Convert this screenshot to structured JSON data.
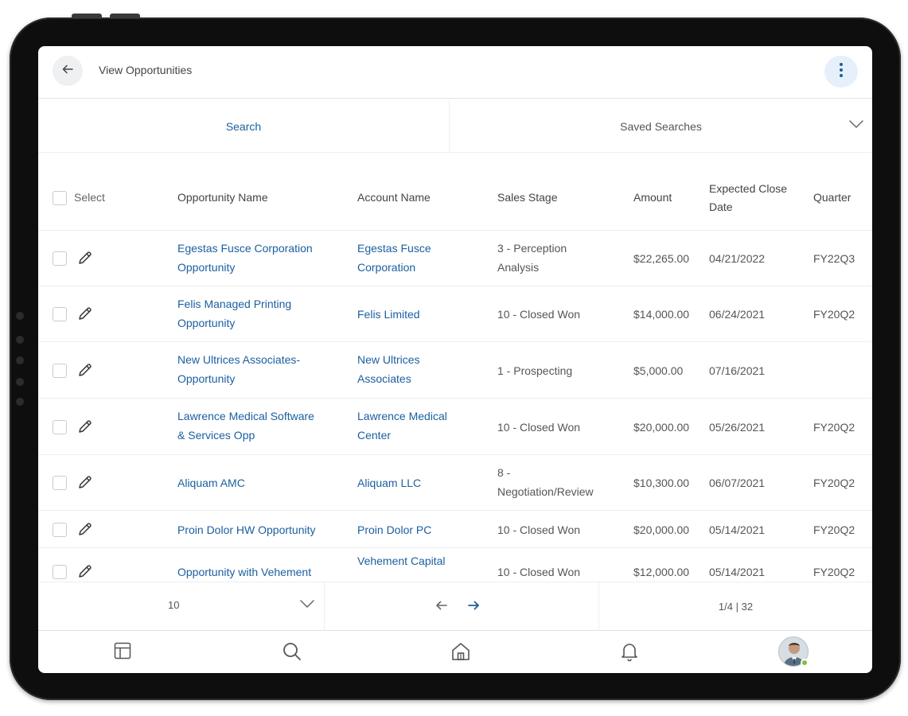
{
  "header": {
    "title": "View Opportunities",
    "back_icon": "arrow-left-icon",
    "more_icon": "more-vertical-icon"
  },
  "tabs": {
    "search_label": "Search",
    "saved_label": "Saved Searches"
  },
  "table": {
    "columns": {
      "select": "Select",
      "opportunity": "Opportunity Name",
      "account": "Account Name",
      "stage": "Sales Stage",
      "amount": "Amount",
      "close_line1": "Expected Close",
      "close_line2": "Date",
      "quarter": "Quarter"
    },
    "rows": [
      {
        "opp1": "Egestas Fusce Corporation",
        "opp2": "Opportunity",
        "acc1": "Egestas Fusce",
        "acc2": "Corporation",
        "stage1": "3 - Perception",
        "stage2": "Analysis",
        "amount": "$22,265.00",
        "close": "04/21/2022",
        "quarter": "FY22Q3"
      },
      {
        "opp1": "Felis Managed Printing",
        "opp2": "Opportunity",
        "acc1": "Felis Limited",
        "acc2": "",
        "stage1": "10 - Closed Won",
        "stage2": "",
        "amount": "$14,000.00",
        "close": "06/24/2021",
        "quarter": "FY20Q2"
      },
      {
        "opp1": "New Ultrices Associates-",
        "opp2": "Opportunity",
        "acc1": "New Ultrices",
        "acc2": "Associates",
        "stage1": "1 - Prospecting",
        "stage2": "",
        "amount": "$5,000.00",
        "close": "07/16/2021",
        "quarter": ""
      },
      {
        "opp1": "Lawrence Medical Software",
        "opp2": "& Services Opp",
        "acc1": "Lawrence Medical",
        "acc2": "Center",
        "stage1": "10 - Closed Won",
        "stage2": "",
        "amount": "$20,000.00",
        "close": "05/26/2021",
        "quarter": "FY20Q2"
      },
      {
        "opp1": "Aliquam AMC",
        "opp2": "",
        "acc1": "Aliquam LLC",
        "acc2": "",
        "stage1": "8 -",
        "stage2": "Negotiation/Review",
        "amount": "$10,300.00",
        "close": "06/07/2021",
        "quarter": "FY20Q2"
      },
      {
        "opp1": "Proin Dolor HW Opportunity",
        "opp2": "",
        "acc1": "Proin Dolor PC",
        "acc2": "",
        "stage1": "10 - Closed Won",
        "stage2": "",
        "amount": "$20,000.00",
        "close": "05/14/2021",
        "quarter": "FY20Q2"
      },
      {
        "opp1": "Opportunity with Vehement",
        "opp2": "",
        "acc1": "Vehement Capital",
        "acc2": "",
        "stage1": "10 - Closed Won",
        "stage2": "",
        "amount": "$12,000.00",
        "close": "05/14/2021",
        "quarter": "FY20Q2"
      }
    ]
  },
  "pagination": {
    "page_size": "10",
    "count": "1/4 | 32",
    "prev_icon": "arrow-left-icon",
    "next_icon": "arrow-right-icon"
  },
  "bottom_nav": {
    "items": [
      "dashboard-icon",
      "search-icon",
      "home-icon",
      "bell-icon",
      "avatar"
    ]
  },
  "colors": {
    "link": "#1c5fa0",
    "presence": "#7ac143"
  }
}
